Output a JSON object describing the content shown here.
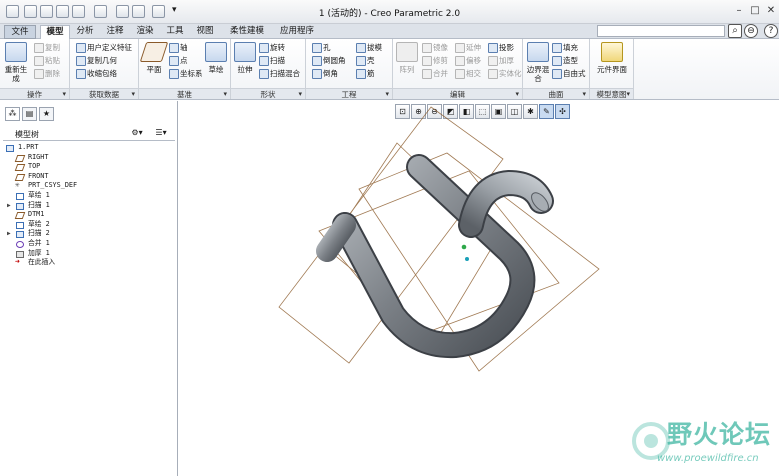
{
  "window": {
    "title": "1 (活动的) - Creo Parametric 2.0",
    "controls": {
      "minimize": "–",
      "maximize": "□",
      "close": "✕"
    }
  },
  "menu": {
    "file": "文件",
    "tabs": [
      "模型",
      "分析",
      "注释",
      "渲染",
      "工具",
      "视图",
      "柔性建模",
      "应用程序"
    ],
    "active_tab": "模型",
    "help": "?"
  },
  "ribbon": {
    "ops": {
      "regen_label": "重新生成",
      "copy": "复制",
      "paste": "粘贴",
      "delete": "删除",
      "group": "操作"
    },
    "getdata": {
      "udf": "用户定义特征",
      "copy_geom": "复制几何",
      "shrinkwrap": "收缩包络",
      "group": "获取数据"
    },
    "datum": {
      "plane": "平面",
      "axis": "轴",
      "point": "点",
      "csys": "坐标系",
      "sketch": "草绘",
      "group": "基准"
    },
    "shapes": {
      "extrude": "拉伸",
      "revolve": "旋转",
      "sweep": "扫描",
      "swept_blend": "扫描混合",
      "group": "形状"
    },
    "engineering": {
      "hole": "孔",
      "round": "倒圆角",
      "chamfer": "倒角",
      "draft": "拔模",
      "shell": "壳",
      "rib": "筋",
      "group": "工程"
    },
    "editing": {
      "pattern": "阵列",
      "mirror": "镜像",
      "trim": "修剪",
      "merge": "合并",
      "extend": "延伸",
      "offset": "偏移",
      "intersect": "相交",
      "project": "投影",
      "thicken": "加厚",
      "solidify": "实体化",
      "group": "编辑"
    },
    "surfaces": {
      "boundary_blend": "边界混合",
      "fill": "填充",
      "style": "造型",
      "freestyle": "自由式",
      "group": "曲面"
    },
    "model_intent": {
      "component_interface": "元件界面",
      "group": "模型意图"
    }
  },
  "left_panel": {
    "tree_title": "模型树",
    "nodes": [
      {
        "label": "1.PRT",
        "icon": "part-icon",
        "expandable": false
      },
      {
        "label": "RIGHT",
        "icon": "datum-plane-icon",
        "expandable": false
      },
      {
        "label": "TOP",
        "icon": "datum-plane-icon",
        "expandable": false
      },
      {
        "label": "FRONT",
        "icon": "datum-plane-icon",
        "expandable": false
      },
      {
        "label": "PRT_CSYS_DEF",
        "icon": "csys-icon",
        "expandable": false
      },
      {
        "label": "草绘 1",
        "icon": "sketch-icon",
        "expandable": false
      },
      {
        "label": "扫描 1",
        "icon": "sweep-icon",
        "expandable": true
      },
      {
        "label": "DTM1",
        "icon": "datum-plane-icon",
        "expandable": false
      },
      {
        "label": "草绘 2",
        "icon": "sketch-icon",
        "expandable": false
      },
      {
        "label": "扫描 2",
        "icon": "sweep-icon",
        "expandable": true
      },
      {
        "label": "合并 1",
        "icon": "merge-icon",
        "expandable": false
      },
      {
        "label": "加厚 1",
        "icon": "thicken-icon",
        "expandable": false
      },
      {
        "label": "在此插入",
        "icon": "insert-here-icon",
        "expandable": false
      }
    ]
  },
  "watermark": {
    "text": "野火论坛",
    "url": "www.proewildfire.cn"
  },
  "colors": {
    "ribbon_accent": "#5b7fb0",
    "model_gray": "#8a8f94",
    "datum_plane": "#8a5a2a",
    "watermark": "#3fb6a2"
  }
}
